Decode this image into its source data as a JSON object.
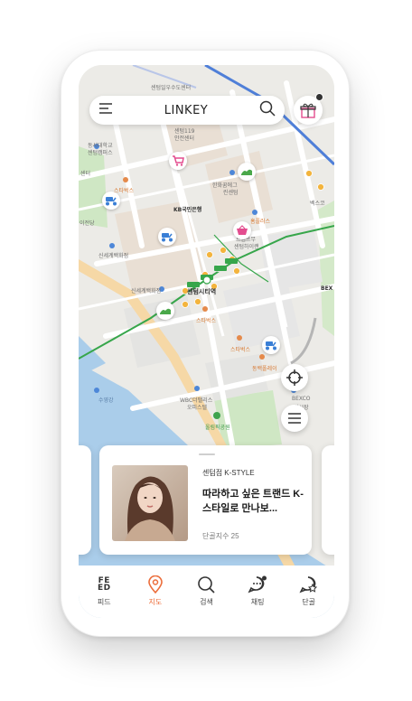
{
  "header": {
    "title": "LINKEY",
    "menu_icon": "menu-icon",
    "search_icon": "search-icon",
    "gift_icon": "gift-icon"
  },
  "map": {
    "top_street_label": "센텀일우수도센터",
    "labels": [
      {
        "name": "center-119",
        "text": "센텀119",
        "style": ""
      },
      {
        "name": "center-safety",
        "text": "안전센터",
        "style": ""
      },
      {
        "name": "dongseo-univ",
        "text": "동서대학교",
        "style": ""
      },
      {
        "name": "dongseo-campus",
        "text": "센텀캠퍼스",
        "style": ""
      },
      {
        "name": "center-left",
        "text": "센터",
        "style": ""
      },
      {
        "name": "starbucks-1",
        "text": "스타벅스",
        "style": "orange"
      },
      {
        "name": "hanhwa-1",
        "text": "한화꿈에그",
        "style": ""
      },
      {
        "name": "hanhwa-2",
        "text": "린센텀",
        "style": ""
      },
      {
        "name": "kb-bank",
        "text": "KB국민은행",
        "style": "bold"
      },
      {
        "name": "homeplus",
        "text": "홈플러스",
        "style": "orange"
      },
      {
        "name": "ichungdang",
        "text": "이전당",
        "style": ""
      },
      {
        "name": "trade-1",
        "text": "트럼프무",
        "style": ""
      },
      {
        "name": "trade-2",
        "text": "센텀하이랜",
        "style": ""
      },
      {
        "name": "shinsegae-1",
        "text": "신세계백화점",
        "style": ""
      },
      {
        "name": "shinsegae-2",
        "text": "신세계백화점",
        "style": ""
      },
      {
        "name": "bexco-right",
        "text": "BEX",
        "style": "bold"
      },
      {
        "name": "centum-station",
        "text": "센텀시티역",
        "style": "bold"
      },
      {
        "name": "starbucks-2",
        "text": "스타벅스",
        "style": "orange"
      },
      {
        "name": "starbucks-3",
        "text": "스타벅스",
        "style": "orange"
      },
      {
        "name": "dongbaek",
        "text": "동백폴레이",
        "style": "orange"
      },
      {
        "name": "suyeong",
        "text": "수영강",
        "style": ""
      },
      {
        "name": "wbc-1",
        "text": "WBC더팰리스",
        "style": ""
      },
      {
        "name": "wbc-2",
        "text": "오피스텔",
        "style": ""
      },
      {
        "name": "bexco-1",
        "text": "BEXCO",
        "style": ""
      },
      {
        "name": "bexco-2",
        "text": "전시장",
        "style": ""
      },
      {
        "name": "olympic-park",
        "text": "올림픽공원",
        "style": "green"
      },
      {
        "name": "bexco-corner",
        "text": "벡스코",
        "style": ""
      }
    ],
    "locate_icon": "crosshair-icon",
    "list_icon": "list-icon"
  },
  "card": {
    "shop": "센텀점 K-STYLE",
    "title": "따라하고 싶은 트랜드 K-스타일로 만나보...",
    "meta": "단골지수 25"
  },
  "tabs": [
    {
      "name": "feed",
      "label": "피드",
      "icon": "feed-icon"
    },
    {
      "name": "map",
      "label": "지도",
      "icon": "map-pin-icon",
      "active": true
    },
    {
      "name": "search",
      "label": "검색",
      "icon": "search-icon"
    },
    {
      "name": "chat",
      "label": "채팅",
      "icon": "chat-icon"
    },
    {
      "name": "regular",
      "label": "단골",
      "icon": "star-chat-icon"
    }
  ],
  "colors": {
    "accent": "#ec6d3a",
    "subway_line": "#37a64b",
    "station_marker": "#f3b43d",
    "marker_blue": "#3a7fd6",
    "marker_green": "#4aa84a",
    "marker_pink": "#e34d8f"
  }
}
